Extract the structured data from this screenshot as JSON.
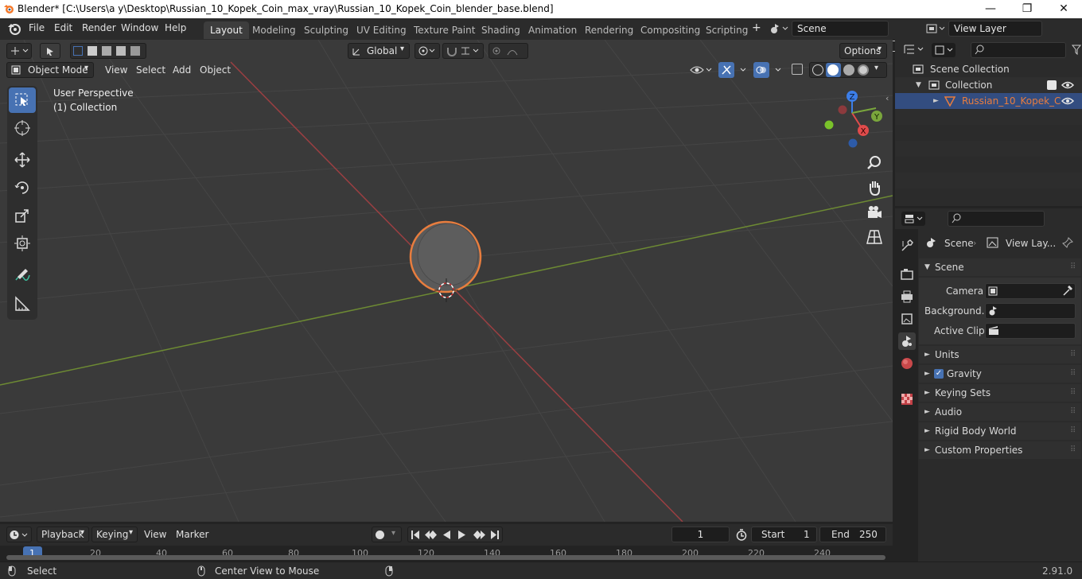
{
  "window": {
    "title": "Blender* [C:\\Users\\a y\\Desktop\\Russian_10_Kopek_Coin_max_vray\\Russian_10_Kopek_Coin_blender_base.blend]",
    "minimize": "—",
    "maximize": "❐",
    "close": "✕"
  },
  "menu": [
    "File",
    "Edit",
    "Render",
    "Window",
    "Help"
  ],
  "workspaces": [
    "Layout",
    "Modeling",
    "Sculpting",
    "UV Editing",
    "Texture Paint",
    "Shading",
    "Animation",
    "Rendering",
    "Compositing",
    "Scripting"
  ],
  "active_workspace": "Layout",
  "add_workspace": "+",
  "scene": {
    "name": "Scene",
    "view_layer": "View Layer"
  },
  "viewport_header": {
    "transform_orientation": "Global",
    "options": "Options",
    "mode": "Object Mode",
    "menus": [
      "View",
      "Select",
      "Add",
      "Object"
    ]
  },
  "viewport": {
    "perspective": "User Perspective",
    "collection": "(1) Collection",
    "gizmo": {
      "z": "Z",
      "y": "Y",
      "x": "X"
    }
  },
  "outliner": {
    "root": "Scene Collection",
    "collection": "Collection",
    "object": "Russian_10_Kopek_C"
  },
  "properties": {
    "breadcrumb": [
      "Scene",
      "View Lay..."
    ],
    "panel": "Scene",
    "fields": [
      {
        "label": "Camera"
      },
      {
        "label": "Background..."
      },
      {
        "label": "Active Clip"
      }
    ],
    "sections": [
      "Units",
      "Gravity",
      "Keying Sets",
      "Audio",
      "Rigid Body World",
      "Custom Properties"
    ]
  },
  "timeline": {
    "menus": [
      "Playback",
      "Keying",
      "View",
      "Marker"
    ],
    "current_frame": "1",
    "start_label": "Start",
    "start": "1",
    "end_label": "End",
    "end": "250",
    "ticks": [
      "1",
      "20",
      "40",
      "60",
      "80",
      "100",
      "120",
      "140",
      "160",
      "180",
      "200",
      "220",
      "240"
    ]
  },
  "status": {
    "select": "Select",
    "center": "Center View to Mouse",
    "version": "2.91.0"
  },
  "colors": {
    "accent": "#4772b3",
    "selected_object": "#e87d3e",
    "x_axis": "#c9474b",
    "y_axis": "#82a23c"
  }
}
